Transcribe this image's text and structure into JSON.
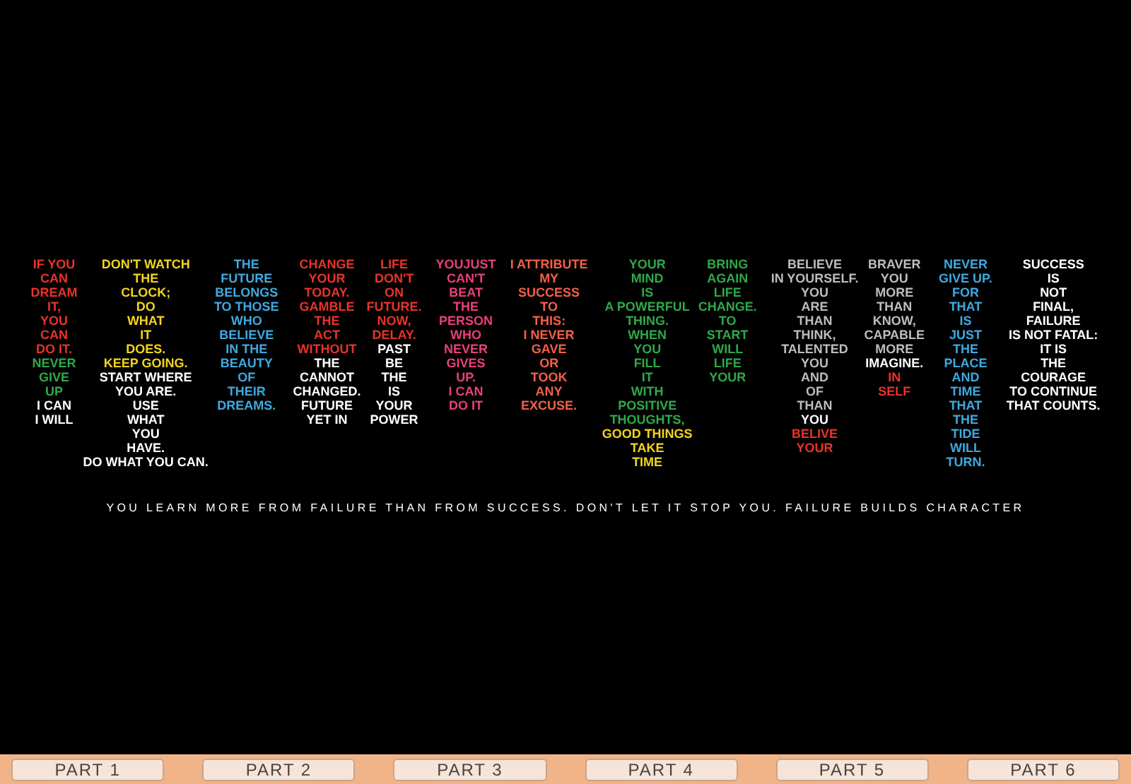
{
  "poster": {
    "letters": [
      {
        "columns": [
          {
            "lines": [
              {
                "text": "IF YOU",
                "color": "#e8332a"
              },
              {
                "text": "CAN",
                "color": "#e8332a"
              },
              {
                "text": "DREAM",
                "color": "#e8332a"
              },
              {
                "text": "IT,",
                "color": "#e8332a"
              },
              {
                "text": "YOU",
                "color": "#e8332a"
              },
              {
                "text": "CAN",
                "color": "#e8332a"
              },
              {
                "text": "DO IT.",
                "color": "#e8332a"
              },
              {
                "text": "NEVER",
                "color": "#2fa84a"
              },
              {
                "text": "GIVE",
                "color": "#2fa84a"
              },
              {
                "text": "UP",
                "color": "#2fa84a"
              },
              {
                "text": "I CAN",
                "color": "#ffffff"
              },
              {
                "text": "I WILL",
                "color": "#ffffff"
              }
            ]
          },
          {
            "lines": [
              {
                "text": "DON'T WATCH",
                "color": "#f2d41f"
              },
              {
                "text": "THE",
                "color": "#f2d41f"
              },
              {
                "text": "CLOCK;",
                "color": "#f2d41f"
              },
              {
                "text": "DO",
                "color": "#f2d41f"
              },
              {
                "text": "WHAT",
                "color": "#f2d41f"
              },
              {
                "text": "IT",
                "color": "#f2d41f"
              },
              {
                "text": "DOES.",
                "color": "#f2d41f"
              },
              {
                "text": "KEEP GOING.",
                "color": "#f2d41f"
              },
              {
                "text": "START WHERE",
                "color": "#ffffff"
              },
              {
                "text": "YOU ARE.",
                "color": "#ffffff"
              },
              {
                "text": "USE",
                "color": "#ffffff"
              },
              {
                "text": "WHAT",
                "color": "#ffffff"
              },
              {
                "text": "YOU",
                "color": "#ffffff"
              },
              {
                "text": "HAVE.",
                "color": "#ffffff"
              },
              {
                "text": "DO WHAT YOU CAN.",
                "color": "#ffffff"
              }
            ]
          },
          {
            "lines": [
              {
                "text": "THE",
                "color": "#3fa9e0"
              },
              {
                "text": "FUTURE",
                "color": "#3fa9e0"
              },
              {
                "text": "BELONGS",
                "color": "#3fa9e0"
              },
              {
                "text": "TO THOSE",
                "color": "#3fa9e0"
              },
              {
                "text": "WHO",
                "color": "#3fa9e0"
              },
              {
                "text": "BELIEVE",
                "color": "#3fa9e0"
              },
              {
                "text": "IN THE",
                "color": "#3fa9e0"
              },
              {
                "text": "BEAUTY",
                "color": "#3fa9e0"
              },
              {
                "text": "OF",
                "color": "#3fa9e0"
              },
              {
                "text": "THEIR",
                "color": "#3fa9e0"
              },
              {
                "text": "DREAMS.",
                "color": "#3fa9e0"
              }
            ]
          }
        ]
      },
      {
        "columns": [
          {
            "lines": [
              {
                "text": "CHANGE",
                "color": "#e8332a"
              },
              {
                "text": "YOUR",
                "color": "#e8332a"
              },
              {
                "text": "TODAY.",
                "color": "#e8332a"
              },
              {
                "text": "GAMBLE",
                "color": "#e8332a"
              },
              {
                "text": "THE",
                "color": "#e8332a"
              },
              {
                "text": "ACT",
                "color": "#e8332a"
              },
              {
                "text": "WITHOUT",
                "color": "#e8332a"
              },
              {
                "text": "THE",
                "color": "#ffffff"
              },
              {
                "text": "CANNOT",
                "color": "#ffffff"
              },
              {
                "text": "CHANGED.",
                "color": "#ffffff"
              },
              {
                "text": "FUTURE",
                "color": "#ffffff"
              },
              {
                "text": "YET IN",
                "color": "#ffffff"
              }
            ]
          },
          {
            "lines": [
              {
                "text": "LIFE",
                "color": "#e8332a"
              },
              {
                "text": "DON'T",
                "color": "#e8332a"
              },
              {
                "text": "ON",
                "color": "#e8332a"
              },
              {
                "text": "FUTURE.",
                "color": "#e8332a"
              },
              {
                "text": "NOW,",
                "color": "#e8332a"
              },
              {
                "text": "DELAY.",
                "color": "#e8332a"
              },
              {
                "text": "PAST",
                "color": "#ffffff"
              },
              {
                "text": "BE",
                "color": "#ffffff"
              },
              {
                "text": "THE",
                "color": "#ffffff"
              },
              {
                "text": "IS",
                "color": "#ffffff"
              },
              {
                "text": "YOUR",
                "color": "#ffffff"
              },
              {
                "text": "POWER",
                "color": "#ffffff"
              }
            ]
          }
        ]
      },
      {
        "columns": [
          {
            "lines": [
              {
                "text": "YOUJUST",
                "color": "#e8407a"
              },
              {
                "text": "CAN'T",
                "color": "#e8407a"
              },
              {
                "text": "BEAT",
                "color": "#e8407a"
              },
              {
                "text": "THE",
                "color": "#e8407a"
              },
              {
                "text": "PERSON",
                "color": "#e8407a"
              },
              {
                "text": "WHO",
                "color": "#e8407a"
              },
              {
                "text": "NEVER",
                "color": "#e8407a"
              },
              {
                "text": "GIVES",
                "color": "#e8407a"
              },
              {
                "text": "UP.",
                "color": "#e8407a"
              },
              {
                "text": "I CAN",
                "color": "#e8407a"
              },
              {
                "text": "DO IT",
                "color": "#e8407a"
              }
            ]
          }
        ]
      },
      {
        "columns": [
          {
            "lines": [
              {
                "text": "I ATTRIBUTE",
                "color": "#f2604a"
              },
              {
                "text": "MY",
                "color": "#f2604a"
              },
              {
                "text": "SUCCESS",
                "color": "#f2604a"
              },
              {
                "text": "TO",
                "color": "#f2604a"
              },
              {
                "text": "THIS:",
                "color": "#f2604a"
              },
              {
                "text": "I NEVER",
                "color": "#f2604a"
              },
              {
                "text": "GAVE",
                "color": "#f2604a"
              },
              {
                "text": "OR",
                "color": "#f2604a"
              },
              {
                "text": "TOOK",
                "color": "#f2604a"
              },
              {
                "text": "ANY",
                "color": "#f2604a"
              },
              {
                "text": "EXCUSE.",
                "color": "#f2604a"
              }
            ]
          }
        ]
      },
      {
        "columns": [
          {
            "lines": [
              {
                "text": "YOUR",
                "color": "#2fa84a"
              },
              {
                "text": "MIND",
                "color": "#2fa84a"
              },
              {
                "text": "IS",
                "color": "#2fa84a"
              },
              {
                "text": "A POWERFUL",
                "color": "#2fa84a"
              },
              {
                "text": "THING.",
                "color": "#2fa84a"
              },
              {
                "text": "WHEN",
                "color": "#2fa84a"
              },
              {
                "text": "YOU",
                "color": "#2fa84a"
              },
              {
                "text": "FILL",
                "color": "#2fa84a"
              },
              {
                "text": "IT",
                "color": "#2fa84a"
              },
              {
                "text": "WITH",
                "color": "#2fa84a"
              },
              {
                "text": "POSITIVE",
                "color": "#2fa84a"
              },
              {
                "text": "THOUGHTS,",
                "color": "#2fa84a"
              },
              {
                "text": "GOOD THINGS",
                "color": "#f2d41f"
              },
              {
                "text": "TAKE",
                "color": "#f2d41f"
              },
              {
                "text": "TIME",
                "color": "#f2d41f"
              }
            ]
          },
          {
            "lines": [
              {
                "text": "BRING",
                "color": "#2fa84a"
              },
              {
                "text": "AGAIN",
                "color": "#2fa84a"
              },
              {
                "text": "LIFE",
                "color": "#2fa84a"
              },
              {
                "text": "CHANGE.",
                "color": "#2fa84a"
              },
              {
                "text": "TO",
                "color": "#2fa84a"
              },
              {
                "text": "START",
                "color": "#2fa84a"
              },
              {
                "text": "WILL",
                "color": "#2fa84a"
              },
              {
                "text": "LIFE",
                "color": "#2fa84a"
              },
              {
                "text": "YOUR",
                "color": "#2fa84a"
              }
            ]
          }
        ]
      },
      {
        "columns": [
          {
            "lines": [
              {
                "text": "BELIEVE",
                "color": "#bdbdbd"
              },
              {
                "text": "IN YOURSELF.",
                "color": "#bdbdbd"
              },
              {
                "text": "YOU",
                "color": "#bdbdbd"
              },
              {
                "text": "ARE",
                "color": "#bdbdbd"
              },
              {
                "text": "THAN",
                "color": "#bdbdbd"
              },
              {
                "text": "THINK,",
                "color": "#bdbdbd"
              },
              {
                "text": "TALENTED",
                "color": "#bdbdbd"
              },
              {
                "text": "YOU",
                "color": "#bdbdbd"
              },
              {
                "text": "AND",
                "color": "#bdbdbd"
              },
              {
                "text": "OF",
                "color": "#bdbdbd"
              },
              {
                "text": "THAN",
                "color": "#bdbdbd"
              },
              {
                "text": "YOU",
                "color": "#ffffff"
              },
              {
                "text": "BELIVE",
                "color": "#e8332a"
              },
              {
                "text": "YOUR",
                "color": "#e8332a"
              }
            ]
          },
          {
            "lines": [
              {
                "text": "BRAVER",
                "color": "#bdbdbd"
              },
              {
                "text": "YOU",
                "color": "#bdbdbd"
              },
              {
                "text": "MORE",
                "color": "#bdbdbd"
              },
              {
                "text": "THAN",
                "color": "#bdbdbd"
              },
              {
                "text": "KNOW,",
                "color": "#bdbdbd"
              },
              {
                "text": "CAPABLE",
                "color": "#bdbdbd"
              },
              {
                "text": "MORE",
                "color": "#bdbdbd"
              },
              {
                "text": "IMAGINE.",
                "color": "#ffffff"
              },
              {
                "text": "IN",
                "color": "#e8332a"
              },
              {
                "text": "SELF",
                "color": "#e8332a"
              }
            ]
          }
        ]
      },
      {
        "columns": [
          {
            "lines": [
              {
                "text": "NEVER",
                "color": "#3fa9e0"
              },
              {
                "text": "GIVE UP.",
                "color": "#3fa9e0"
              },
              {
                "text": "FOR",
                "color": "#3fa9e0"
              },
              {
                "text": "THAT",
                "color": "#3fa9e0"
              },
              {
                "text": "IS",
                "color": "#3fa9e0"
              },
              {
                "text": "JUST",
                "color": "#3fa9e0"
              },
              {
                "text": "THE",
                "color": "#3fa9e0"
              },
              {
                "text": "PLACE",
                "color": "#3fa9e0"
              },
              {
                "text": "AND",
                "color": "#3fa9e0"
              },
              {
                "text": "TIME",
                "color": "#3fa9e0"
              },
              {
                "text": "THAT",
                "color": "#3fa9e0"
              },
              {
                "text": "THE",
                "color": "#3fa9e0"
              },
              {
                "text": "TIDE",
                "color": "#3fa9e0"
              },
              {
                "text": "WILL",
                "color": "#3fa9e0"
              },
              {
                "text": "TURN.",
                "color": "#3fa9e0"
              }
            ]
          }
        ]
      },
      {
        "columns": [
          {
            "lines": [
              {
                "text": "SUCCESS",
                "color": "#ffffff"
              },
              {
                "text": "IS",
                "color": "#ffffff"
              },
              {
                "text": "NOT",
                "color": "#ffffff"
              },
              {
                "text": "FINAL,",
                "color": "#ffffff"
              },
              {
                "text": "FAILURE",
                "color": "#ffffff"
              },
              {
                "text": "IS NOT FATAL:",
                "color": "#ffffff"
              },
              {
                "text": "IT IS",
                "color": "#ffffff"
              },
              {
                "text": "THE",
                "color": "#ffffff"
              },
              {
                "text": "COURAGE",
                "color": "#ffffff"
              },
              {
                "text": "TO CONTINUE",
                "color": "#ffffff"
              },
              {
                "text": "THAT COUNTS.",
                "color": "#ffffff"
              }
            ]
          }
        ]
      }
    ],
    "tagline": "YOU LEARN MORE FROM FAILURE THAN FROM SUCCESS. DON'T LET IT STOP YOU. FAILURE BUILDS CHARACTER"
  },
  "parts": [
    "PART 1",
    "PART 2",
    "PART 3",
    "PART 4",
    "PART 5",
    "PART 6"
  ]
}
